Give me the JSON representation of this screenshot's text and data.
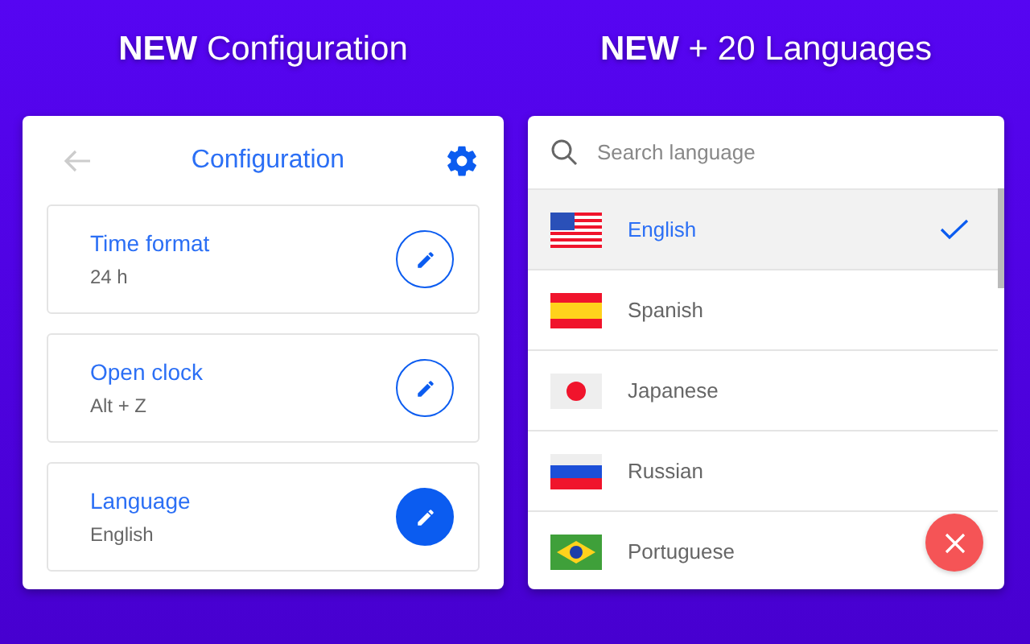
{
  "left": {
    "heading": "**NEW** Configuration",
    "title": "Configuration",
    "settings": [
      {
        "label": "Time format",
        "value": "24 h",
        "active": false
      },
      {
        "label": "Open clock",
        "value": "Alt + Z",
        "active": false
      },
      {
        "label": "Language",
        "value": "English",
        "active": true
      }
    ]
  },
  "right": {
    "heading": "**NEW** + 20 Languages",
    "search": {
      "placeholder": "Search language"
    },
    "languages": [
      {
        "name": "English",
        "kind": "us",
        "selected": true
      },
      {
        "name": "Spanish",
        "kind": "es",
        "selected": false
      },
      {
        "name": "Japanese",
        "kind": "jp",
        "selected": false
      },
      {
        "name": "Russian",
        "kind": "ru",
        "selected": false
      },
      {
        "name": "Portuguese",
        "kind": "br",
        "selected": false
      }
    ]
  }
}
